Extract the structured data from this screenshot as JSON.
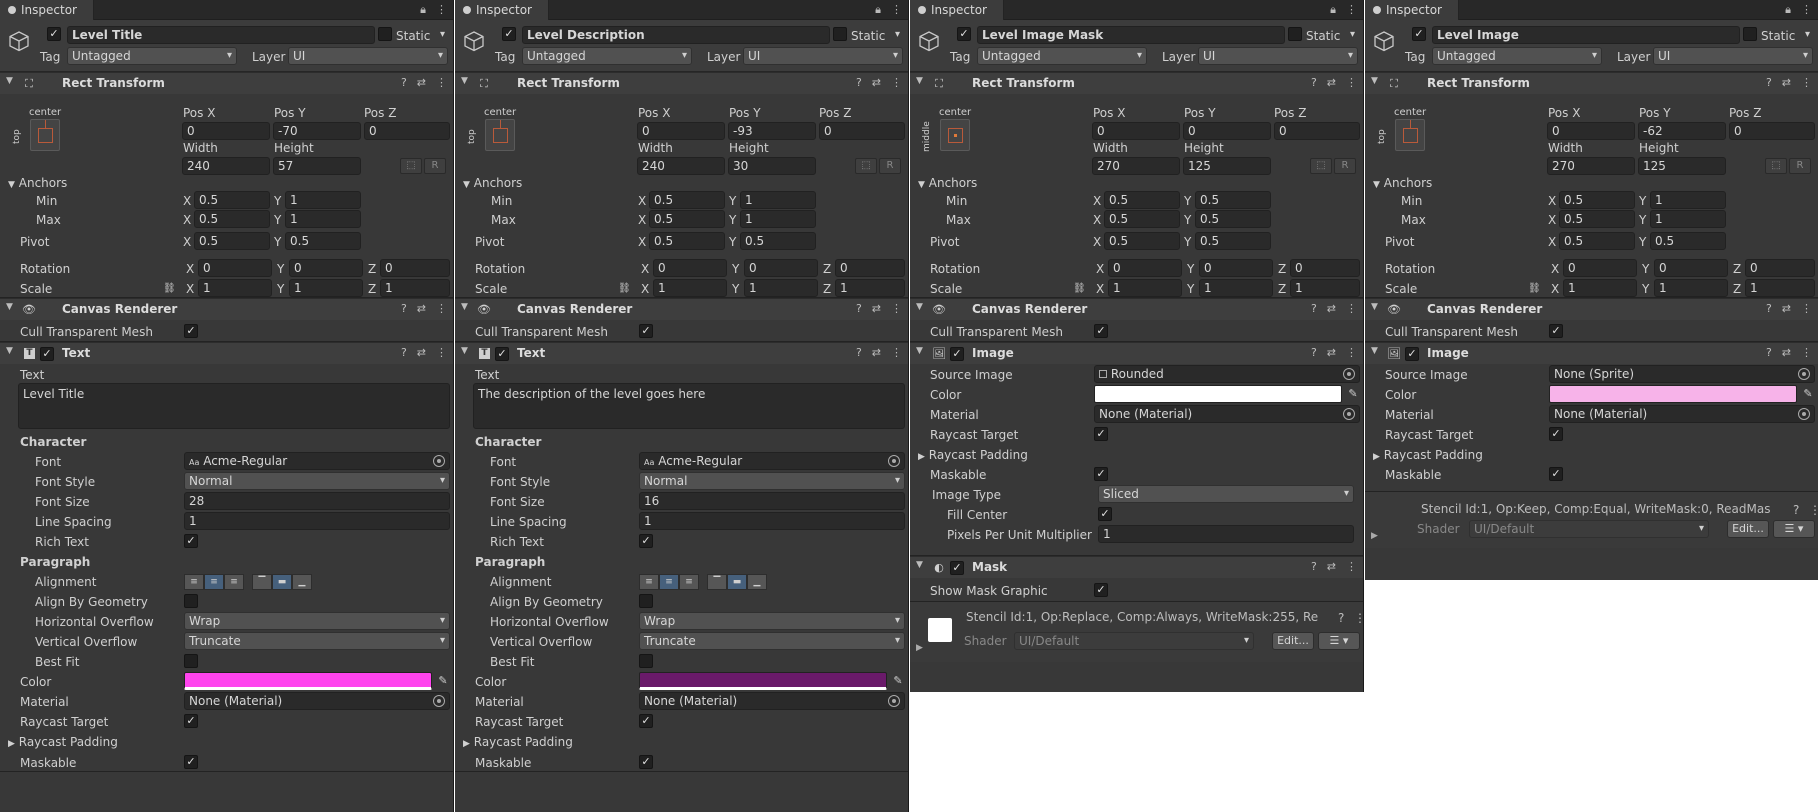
{
  "common": {
    "tab_label": "Inspector",
    "static_label": "Static",
    "tag_label": "Tag",
    "layer_label": "Layer",
    "tag_value": "Untagged",
    "layer_value": "UI",
    "rect_transform_title": "Rect Transform",
    "posx_label": "Pos X",
    "posy_label": "Pos Y",
    "posz_label": "Pos Z",
    "width_label": "Width",
    "height_label": "Height",
    "anchor_horizontal": "center",
    "anchors_label": "Anchors",
    "min_label": "Min",
    "max_label": "Max",
    "pivot_label": "Pivot",
    "rotation_label": "Rotation",
    "scale_label": "Scale",
    "x": "X",
    "y": "Y",
    "z": "Z",
    "r_label": "R",
    "canvas_renderer_title": "Canvas Renderer",
    "cull_label": "Cull Transparent Mesh",
    "check": "✓"
  },
  "panels": [
    {
      "name": "Level Title",
      "anchor_vertical": "top",
      "pos": [
        "0",
        "-70",
        "0"
      ],
      "size": [
        "240",
        "57"
      ],
      "anchor_min": [
        "0.5",
        "1"
      ],
      "anchor_max": [
        "0.5",
        "1"
      ],
      "pivot": [
        "0.5",
        "0.5"
      ],
      "rotation": [
        "0",
        "0",
        "0"
      ],
      "scale": [
        "1",
        "1",
        "1"
      ]
    },
    {
      "name": "Level Description",
      "anchor_vertical": "top",
      "pos": [
        "0",
        "-93",
        "0"
      ],
      "size": [
        "240",
        "30"
      ],
      "anchor_min": [
        "0.5",
        "1"
      ],
      "anchor_max": [
        "0.5",
        "1"
      ],
      "pivot": [
        "0.5",
        "0.5"
      ],
      "rotation": [
        "0",
        "0",
        "0"
      ],
      "scale": [
        "1",
        "1",
        "1"
      ]
    },
    {
      "name": "Level Image Mask",
      "anchor_vertical": "middle",
      "pos": [
        "0",
        "0",
        "0"
      ],
      "size": [
        "270",
        "125"
      ],
      "anchor_min": [
        "0.5",
        "0.5"
      ],
      "anchor_max": [
        "0.5",
        "0.5"
      ],
      "pivot": [
        "0.5",
        "0.5"
      ],
      "rotation": [
        "0",
        "0",
        "0"
      ],
      "scale": [
        "1",
        "1",
        "1"
      ]
    },
    {
      "name": "Level Image",
      "anchor_vertical": "top",
      "pos": [
        "0",
        "-62",
        "0"
      ],
      "size": [
        "270",
        "125"
      ],
      "anchor_min": [
        "0.5",
        "1"
      ],
      "anchor_max": [
        "0.5",
        "1"
      ],
      "pivot": [
        "0.5",
        "0.5"
      ],
      "rotation": [
        "0",
        "0",
        "0"
      ],
      "scale": [
        "1",
        "1",
        "1"
      ]
    }
  ],
  "text_comp": {
    "title": "Text",
    "text_label": "Text",
    "character_label": "Character",
    "font_label": "Font",
    "font_style_label": "Font Style",
    "font_size_label": "Font Size",
    "line_spacing_label": "Line Spacing",
    "rich_text_label": "Rich Text",
    "paragraph_label": "Paragraph",
    "alignment_label": "Alignment",
    "align_geom_label": "Align By Geometry",
    "h_overflow_label": "Horizontal Overflow",
    "v_overflow_label": "Vertical Overflow",
    "best_fit_label": "Best Fit",
    "color_label": "Color",
    "material_label": "Material",
    "raycast_target_label": "Raycast Target",
    "raycast_padding_label": "Raycast Padding",
    "maskable_label": "Maskable",
    "font_prefix": "Aa",
    "font_value": "Acme-Regular",
    "font_style_value": "Normal",
    "line_spacing_value": "1",
    "h_overflow_value": "Wrap",
    "v_overflow_value": "Truncate",
    "material_value": "None (Material)",
    "texts": [
      "Level Title",
      "The description of the level goes here"
    ],
    "font_sizes": [
      "28",
      "16"
    ],
    "colors": [
      "#ff44ee",
      "#6a1a6a"
    ]
  },
  "image_comp": {
    "title": "Image",
    "source_label": "Source Image",
    "color_label": "Color",
    "material_label": "Material",
    "raycast_target_label": "Raycast Target",
    "raycast_padding_label": "Raycast Padding",
    "maskable_label": "Maskable",
    "image_type_label": "Image Type",
    "fill_center_label": "Fill Center",
    "ppu_label": "Pixels Per Unit Multiplier",
    "material_value": "None (Material)",
    "mask_source": "Rounded",
    "mask_color": "#ffffff",
    "image_type_value": "Sliced",
    "ppu_value": "1",
    "img_source": "None (Sprite)",
    "img_color": "#f7b3e9"
  },
  "mask_comp": {
    "title": "Mask",
    "show_graphic_label": "Show Mask Graphic"
  },
  "stencil": {
    "mask_text": "Stencil Id:1, Op:Replace, Comp:Always, WriteMask:255, Re",
    "image_text": "Stencil Id:1, Op:Keep, Comp:Equal, WriteMask:0, ReadMas",
    "shader_label": "Shader",
    "shader_value": "UI/Default",
    "edit_label": "Edit..."
  }
}
